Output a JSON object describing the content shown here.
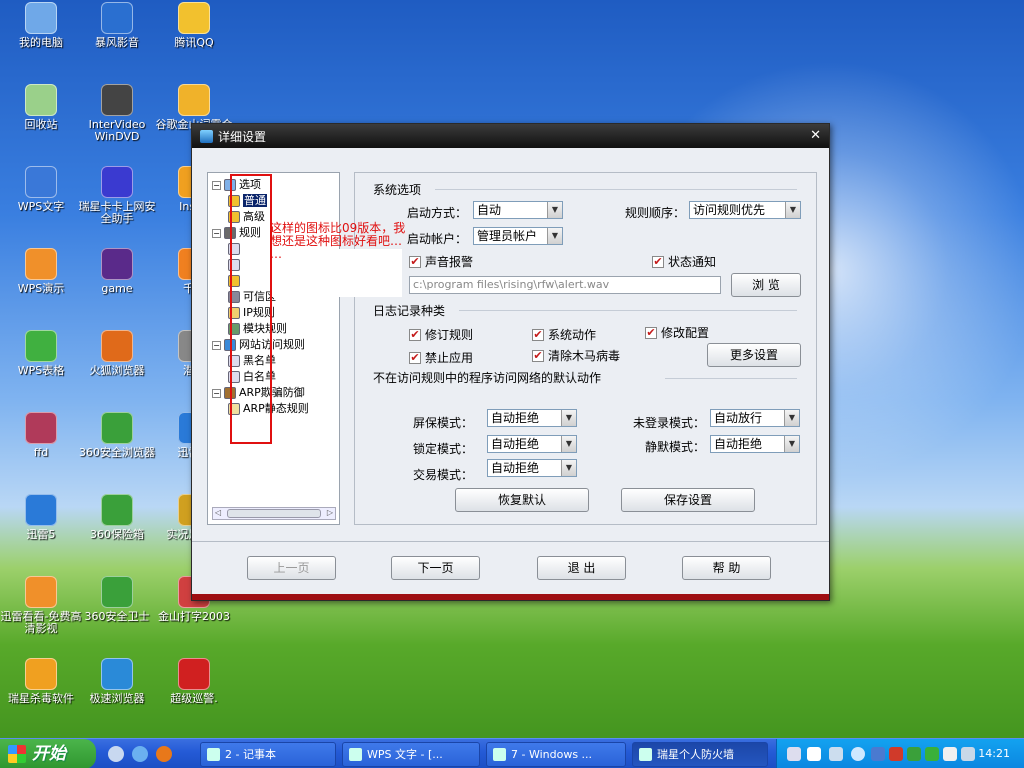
{
  "desktop": {
    "icons": [
      {
        "label": "我的电脑",
        "color": "#6fa8e8"
      },
      {
        "label": "暴风影音",
        "color": "#2a6fd0"
      },
      {
        "label": "腾讯QQ",
        "color": "#f2c12e"
      },
      {
        "label": "回收站",
        "color": "#9ad08a"
      },
      {
        "label": "InterVideo WinDVD",
        "color": "#444"
      },
      {
        "label": "谷歌金山词霸合",
        "color": "#f0b22a"
      },
      {
        "label": "WPS文字",
        "color": "#3a78d8"
      },
      {
        "label": "瑞星卡卡上网安全助手",
        "color": "#3a3ad0"
      },
      {
        "label": "Insan",
        "color": "#f0a020"
      },
      {
        "label": "WPS演示",
        "color": "#f0902a"
      },
      {
        "label": "game",
        "color": "#5a2a8a"
      },
      {
        "label": "千千",
        "color": "#f08020"
      },
      {
        "label": "WPS表格",
        "color": "#40b040"
      },
      {
        "label": "火狐浏览器",
        "color": "#e06a1a"
      },
      {
        "label": "潜意",
        "color": "#888"
      },
      {
        "label": "ffd",
        "color": "#b03a5a"
      },
      {
        "label": "360安全浏览器",
        "color": "#3aa03a"
      },
      {
        "label": "迅雷软",
        "color": "#2a7ad8"
      },
      {
        "label": "迅雷5",
        "color": "#2a7ad8"
      },
      {
        "label": "360保险箱",
        "color": "#3aa03a"
      },
      {
        "label": "实况足体中",
        "color": "#d0a020"
      },
      {
        "label": "迅雷看看-免费高清影视",
        "color": "#f0902a"
      },
      {
        "label": "360安全卫士",
        "color": "#3aa03a"
      },
      {
        "label": "金山打字2003",
        "color": "#d04040"
      },
      {
        "label": "瑞星杀毒软件",
        "color": "#f0a020"
      },
      {
        "label": "极速浏览器",
        "color": "#2a8ad8"
      },
      {
        "label": "超级巡警.",
        "color": "#d02020"
      }
    ]
  },
  "window": {
    "title": "详细设置",
    "close_glyph": "✕",
    "tree": [
      {
        "label": "选项",
        "expand": "−",
        "icon_color": "#7fb0e8"
      },
      {
        "label": "普通",
        "icon_color": "#f0c030"
      },
      {
        "label": "高级",
        "icon_color": "#f0c030"
      },
      {
        "label": "规则",
        "expand": "−",
        "icon_color": "#6a6a6a"
      },
      {
        "label": "",
        "icon_color": "#dde"
      },
      {
        "label": "",
        "icon_color": "#dde"
      },
      {
        "label": "",
        "icon_color": "#f0c030"
      },
      {
        "label": "可信区",
        "icon_color": "#889"
      },
      {
        "label": "IP规则",
        "icon_color": "#f0d070"
      },
      {
        "label": "模块规则",
        "icon_color": "#6a9a6a"
      },
      {
        "label": "网站访问规则",
        "expand": "−",
        "icon_color": "#3a8ad8"
      },
      {
        "label": "黑名单",
        "icon_color": "#dde"
      },
      {
        "label": "白名单",
        "icon_color": "#dde"
      },
      {
        "label": "ARP欺骗防御",
        "expand": "−",
        "icon_color": "#a07030"
      },
      {
        "label": "ARP静态规则",
        "icon_color": "#f0e0a0"
      }
    ],
    "annotation": "这样的图标比09版本，我\n想还是这种图标好看吧…\n…",
    "sections": {
      "system": "系统选项",
      "log": "日志记录种类",
      "default_action": "不在访问规则中的程序访问网络的默认动作"
    },
    "fields": {
      "startup_mode_label": "启动方式：",
      "startup_mode_value": "自动",
      "rule_order_label": "规则顺序：",
      "rule_order_value": "访问规则优先",
      "startup_account_label": "启动帐户：",
      "startup_account_value": "管理员帐户",
      "sound_alarm": "声音报警",
      "status_notify": "状态通知",
      "sound_path": "c:\\program files\\rising\\rfw\\alert.wav",
      "browse_button": "浏 览"
    },
    "log_options": {
      "modify_rules": "修订规则",
      "system_actions": "系统动作",
      "modify_config": "修改配置",
      "block_apps": "禁止应用",
      "clear_trojans": "清除木马病毒",
      "more_settings": "更多设置"
    },
    "modes": {
      "screensaver_label": "屏保模式：",
      "screensaver_value": "自动拒绝",
      "locked_label": "锁定模式：",
      "locked_value": "自动拒绝",
      "trade_label": "交易模式：",
      "trade_value": "自动拒绝",
      "not_logged_label": "未登录模式：",
      "not_logged_value": "自动放行",
      "silent_label": "静默模式：",
      "silent_value": "自动拒绝"
    },
    "buttons": {
      "restore_default": "恢复默认",
      "save_settings": "保存设置",
      "prev_page": "上一页",
      "next_page": "下一页",
      "exit": "退 出",
      "help": "帮 助"
    },
    "dropdown_glyph": "▼",
    "check_glyph": "✔"
  },
  "taskbar": {
    "start_label": "开始",
    "buttons": [
      {
        "label": "2 - 记事本"
      },
      {
        "label": "WPS 文字 - [..."
      },
      {
        "label": "7 - Windows ..."
      },
      {
        "label": "瑞星个人防火墙"
      }
    ],
    "clock": "14:21"
  }
}
